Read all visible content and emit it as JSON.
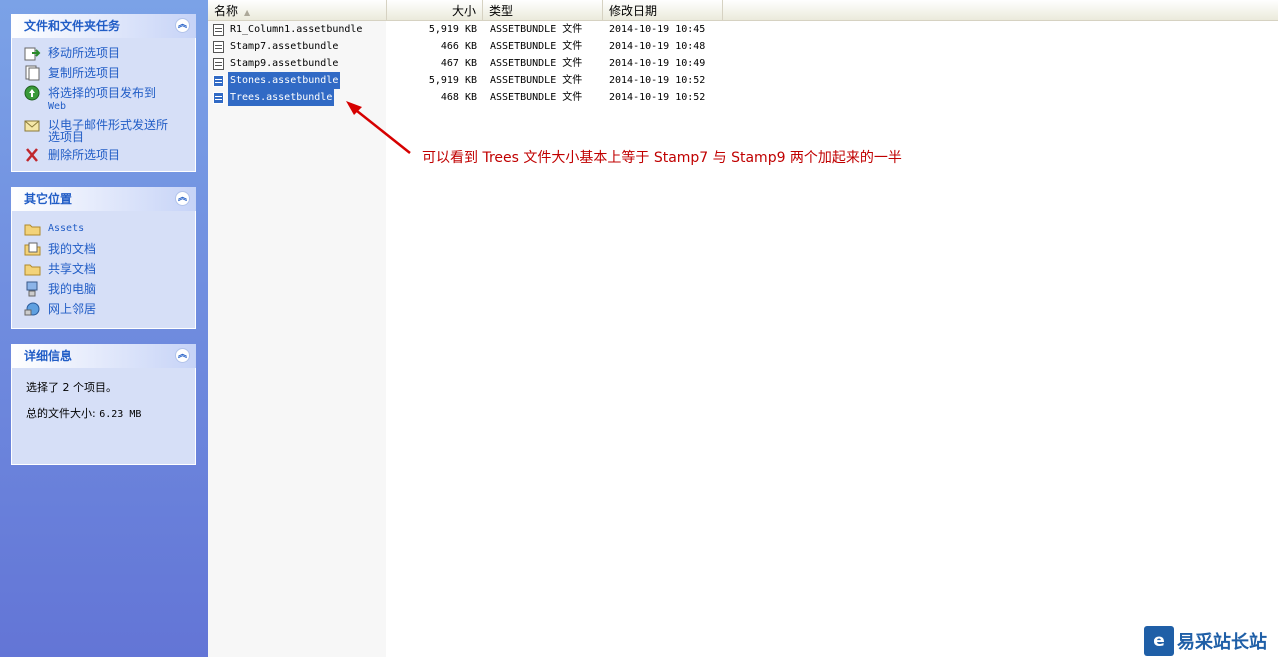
{
  "taskpane": {
    "file_tasks": {
      "title": "文件和文件夹任务",
      "items": [
        {
          "label": "移动所选项目",
          "icon": "move-icon"
        },
        {
          "label": "复制所选项目",
          "icon": "copy-icon"
        },
        {
          "label": "将选择的项目发布到",
          "label2": "Web",
          "icon": "publish-web-icon"
        },
        {
          "label": "以电子邮件形式发送所选项目",
          "icon": "email-icon"
        },
        {
          "label": "删除所选项目",
          "icon": "delete-icon"
        }
      ]
    },
    "other_places": {
      "title": "其它位置",
      "items": [
        {
          "label": "Assets",
          "icon": "folder-icon"
        },
        {
          "label": "我的文档",
          "icon": "my-documents-icon"
        },
        {
          "label": "共享文档",
          "icon": "shared-folder-icon"
        },
        {
          "label": "我的电脑",
          "icon": "my-computer-icon"
        },
        {
          "label": "网上邻居",
          "icon": "network-icon"
        }
      ]
    },
    "details": {
      "title": "详细信息",
      "selected_text": "选择了 2 个项目。",
      "total_size_label": "总的文件大小:",
      "total_size_value": "6.23 MB"
    }
  },
  "listview": {
    "columns": {
      "name": "名称",
      "size": "大小",
      "type": "类型",
      "modified": "修改日期"
    },
    "files": [
      {
        "name": "R1_Column1.assetbundle",
        "size": "5,919 KB",
        "type": "ASSETBUNDLE 文件",
        "modified": "2014-10-19 10:45",
        "selected": false
      },
      {
        "name": "Stamp7.assetbundle",
        "size": "466 KB",
        "type": "ASSETBUNDLE 文件",
        "modified": "2014-10-19 10:48",
        "selected": false
      },
      {
        "name": "Stamp9.assetbundle",
        "size": "467 KB",
        "type": "ASSETBUNDLE 文件",
        "modified": "2014-10-19 10:49",
        "selected": false
      },
      {
        "name": "Stones.assetbundle",
        "size": "5,919 KB",
        "type": "ASSETBUNDLE 文件",
        "modified": "2014-10-19 10:52",
        "selected": true
      },
      {
        "name": "Trees.assetbundle",
        "size": "468 KB",
        "type": "ASSETBUNDLE 文件",
        "modified": "2014-10-19 10:52",
        "selected": true
      }
    ]
  },
  "annotation": "可以看到 Trees 文件大小基本上等于 Stamp7 与 Stamp9 两个加起来的一半",
  "watermark": {
    "text": "易采站长站"
  },
  "colors": {
    "selection": "#316ac5",
    "annotation": "#c00000",
    "task_link": "#215dc6"
  }
}
